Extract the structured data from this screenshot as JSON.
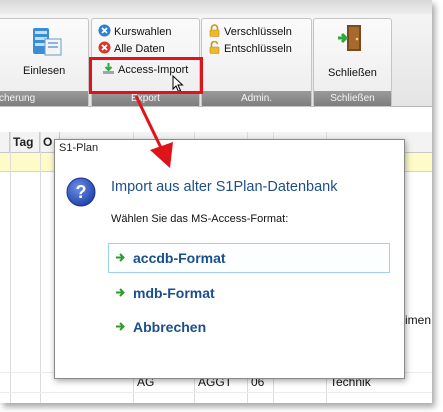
{
  "ribbon": {
    "left_group": {
      "button_label": "Einlesen",
      "footer": "cherung"
    },
    "export_group": {
      "items": [
        {
          "label": "Kurswahlen",
          "icon": "x-circle-blue-icon"
        },
        {
          "label": "Alle Daten",
          "icon": "x-circle-red-icon"
        },
        {
          "label": "Access-Import",
          "icon": "download-arrow-icon"
        }
      ],
      "footer": "Export"
    },
    "admin_group": {
      "items": [
        {
          "label": "Verschlüsseln",
          "icon": "lock-icon"
        },
        {
          "label": "Entschlüsseln",
          "icon": "unlock-icon"
        }
      ],
      "footer": "Admin."
    },
    "close_group": {
      "button_label": "Schließen",
      "footer": "Schließen"
    }
  },
  "grid": {
    "headers": [
      "Tag",
      "O"
    ],
    "bottom_row": [
      "AG",
      "AGGT",
      "06",
      "Technik"
    ],
    "edge_fragment": "imen"
  },
  "dialog": {
    "title": "S1-Plan",
    "heading": "Import aus alter S1Plan-Datenbank",
    "prompt": "Wählen Sie das MS-Access-Format:",
    "commands": [
      {
        "label": "accdb-Format"
      },
      {
        "label": "mdb-Format"
      },
      {
        "label": "Abbrechen"
      }
    ]
  },
  "colors": {
    "highlight": "#e0131b",
    "link": "#1a4f8b",
    "heading": "#1e4e8a",
    "arrow": "#2e9a2e"
  }
}
